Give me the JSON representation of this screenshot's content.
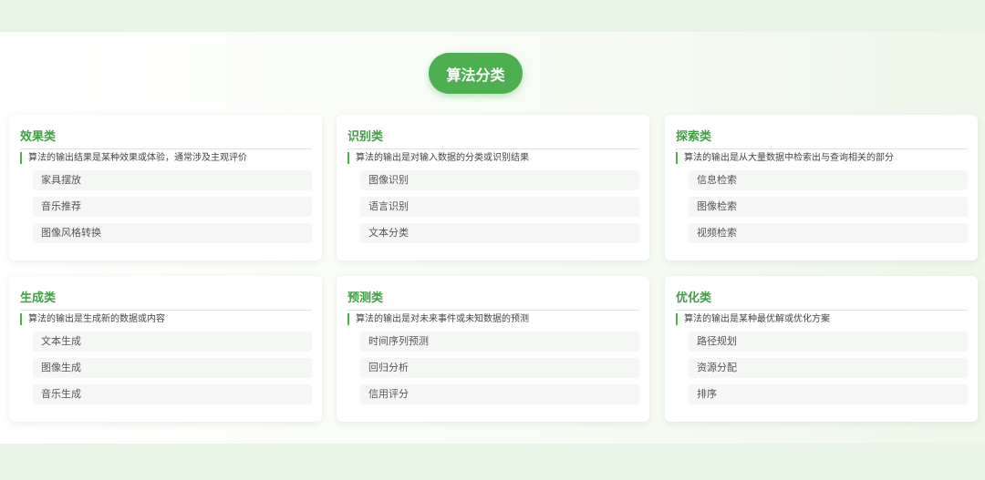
{
  "title": "算法分类",
  "categories": [
    {
      "name": "效果类",
      "desc": "算法的输出结果是某种效果或体验，通常涉及主观评价",
      "items": [
        "家具摆放",
        "音乐推荐",
        "图像风格转换"
      ]
    },
    {
      "name": "识别类",
      "desc": "算法的输出是对输入数据的分类或识别结果",
      "items": [
        "图像识别",
        "语言识别",
        "文本分类"
      ]
    },
    {
      "name": "探索类",
      "desc": "算法的输出是从大量数据中检索出与查询相关的部分",
      "items": [
        "信息检索",
        "图像检索",
        "视频检索"
      ]
    },
    {
      "name": "生成类",
      "desc": "算法的输出是生成新的数据或内容",
      "items": [
        "文本生成",
        "图像生成",
        "音乐生成"
      ]
    },
    {
      "name": "预测类",
      "desc": "算法的输出是对未来事件或未知数据的预测",
      "items": [
        "时间序列预测",
        "回归分析",
        "信用评分"
      ]
    },
    {
      "name": "优化类",
      "desc": "算法的输出是某种最优解或优化方案",
      "items": [
        "路径规划",
        "资源分配",
        "排序"
      ]
    }
  ]
}
